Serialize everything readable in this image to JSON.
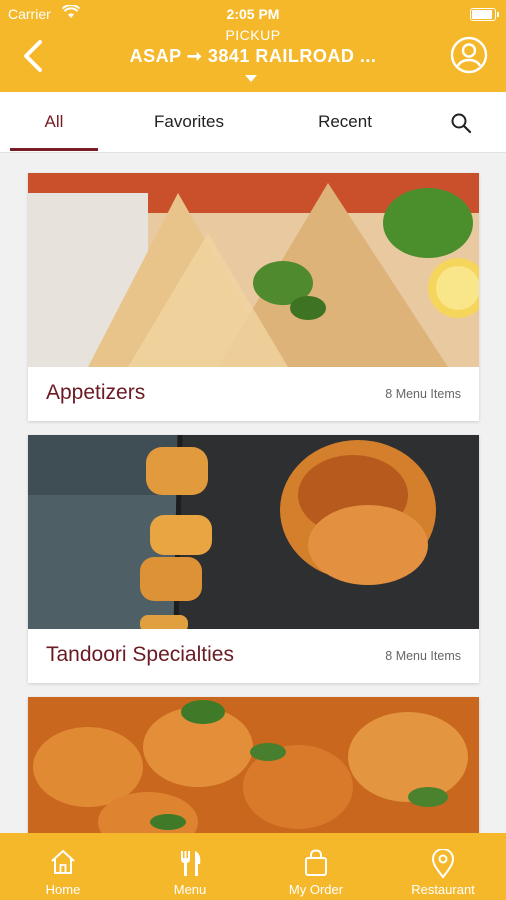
{
  "status_bar": {
    "carrier": "Carrier",
    "time": "2:05 PM"
  },
  "header": {
    "mode": "PICKUP",
    "address": "ASAP ➞ 3841 RAILROAD ..."
  },
  "tabs": [
    {
      "label": "All",
      "active": true
    },
    {
      "label": "Favorites",
      "active": false
    },
    {
      "label": "Recent",
      "active": false
    }
  ],
  "categories": [
    {
      "title": "Appetizers",
      "count": "8 Menu Items"
    },
    {
      "title": "Tandoori Specialties",
      "count": "8 Menu Items"
    },
    {
      "title": "",
      "count": ""
    }
  ],
  "bottom_nav": [
    {
      "label": "Home",
      "icon": "home-icon"
    },
    {
      "label": "Menu",
      "icon": "fork-knife-icon"
    },
    {
      "label": "My Order",
      "icon": "shopping-bag-icon"
    },
    {
      "label": "Restaurant",
      "icon": "location-pin-icon"
    }
  ],
  "colors": {
    "brand_yellow": "#f5b82a",
    "accent_maroon": "#7a1c25"
  }
}
